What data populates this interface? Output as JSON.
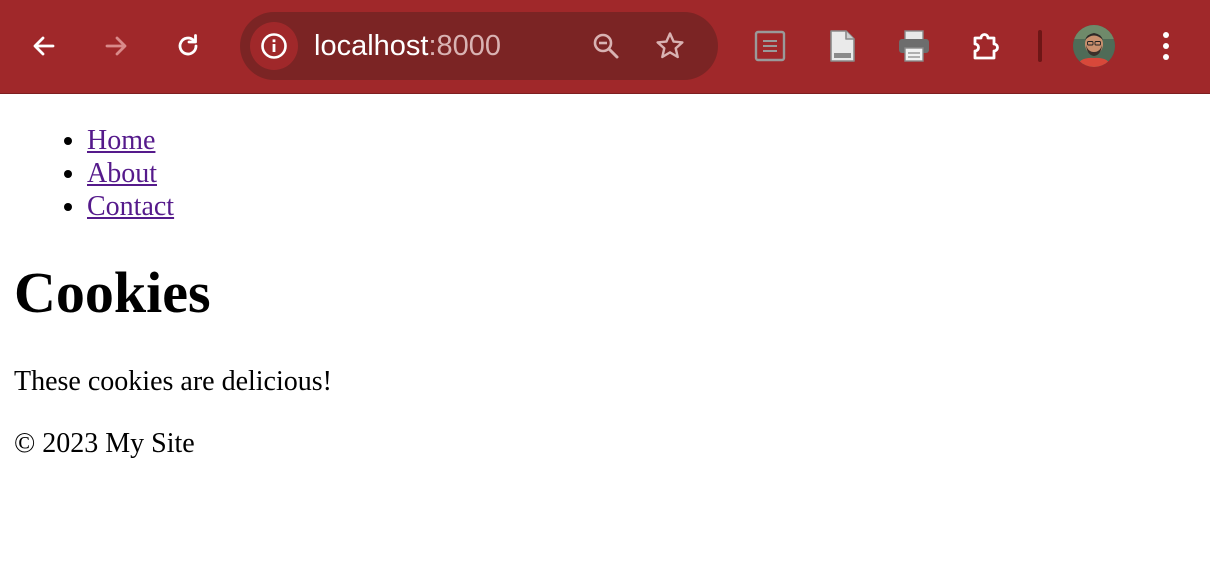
{
  "browser": {
    "url_host": "localhost",
    "url_port": ":8000",
    "icons": {
      "back": "back-arrow-icon",
      "forward": "forward-arrow-icon",
      "reload": "reload-icon",
      "site_info": "info-icon",
      "zoom": "zoom-out-icon",
      "bookmark": "star-icon",
      "reader": "reader-mode-icon",
      "document": "document-icon",
      "print": "printer-icon",
      "extensions": "puzzle-icon",
      "profile": "avatar",
      "menu": "kebab-menu-icon"
    },
    "colors": {
      "toolbar": "#a0282a",
      "omnibox": "#7b2424"
    }
  },
  "nav": {
    "items": [
      {
        "label": "Home"
      },
      {
        "label": "About"
      },
      {
        "label": "Contact"
      }
    ],
    "link_color": "#551a8b"
  },
  "main": {
    "title": "Cookies",
    "paragraph": "These cookies are delicious!"
  },
  "footer": {
    "text": "© 2023 My Site"
  }
}
